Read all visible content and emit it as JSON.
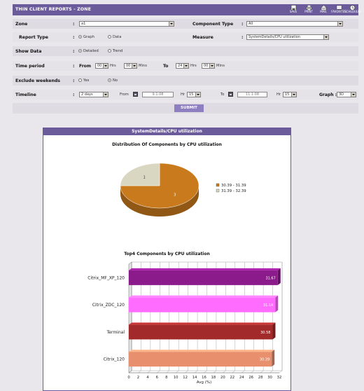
{
  "header": {
    "title": "THIN CLIENT REPORTS - ZONE",
    "buttons": [
      {
        "label": "SAVE",
        "icon": "save-icon"
      },
      {
        "label": "PRINT",
        "icon": "print-icon"
      },
      {
        "label": "MAIL",
        "icon": "mail-icon"
      },
      {
        "label": "FAVORITES",
        "icon": "favorites-icon"
      },
      {
        "label": "SCHEDULES",
        "icon": "schedules-icon"
      }
    ]
  },
  "form": {
    "zone_label": "Zone",
    "zone_value": "a1",
    "component_type_label": "Component Type",
    "component_type_value": "All",
    "report_type_label": "Report Type",
    "report_type_graph": "Graph",
    "report_type_data": "Data",
    "measure_label": "Measure",
    "measure_value": "SystemDetails/CPU utilization",
    "show_data_label": "Show Data",
    "show_data_detailed": "Detailed",
    "show_data_trend": "Trend",
    "time_period_label": "Time period",
    "from_label": "From",
    "from_hrs": "00",
    "from_mins": "00",
    "to_label": "To",
    "to_hrs": "24",
    "to_mins": "00",
    "hrs_label": "Hrs",
    "mins_label": "Mins",
    "exclude_weekends_label": "Exclude weekends",
    "yes_label": "Yes",
    "no_label": "No",
    "timeline_label": "Timeline",
    "timeline_value": "2 days",
    "timeline_from_label": "From",
    "timeline_from_date": "9.1.08",
    "timeline_from_hr": "15",
    "timeline_to_label": "To",
    "timeline_to_date": "11.1.08",
    "timeline_to_hr": "15",
    "hr_label": "Hr",
    "graph_label": "Graph :",
    "graph_value": "3D",
    "submit_label": "SUBMIT"
  },
  "panel": {
    "title": "SystemDetails/CPU utilization"
  },
  "chart_data": [
    {
      "type": "pie",
      "title": "Distribution Of Components by CPU utilization",
      "categories": [
        "30.39 - 31.39",
        "31.39 - 32.39"
      ],
      "values": [
        3,
        1
      ],
      "colors": [
        "#c97a1d",
        "#d9d7c1"
      ],
      "legend": "right"
    },
    {
      "type": "bar",
      "orientation": "horizontal",
      "title": "Top4 Components by CPU utilization",
      "categories": [
        "Citrix_MF_XP_120",
        "Citrix_ZDC_120",
        "Terminal",
        "Citrix_120"
      ],
      "values": [
        31.67,
        31.14,
        30.58,
        30.39
      ],
      "colors": [
        "#8b1a8b",
        "#ff6cff",
        "#a32a2a",
        "#e8906e"
      ],
      "xlabel": "Avg (%)",
      "xlim": [
        0,
        32
      ],
      "xticks": [
        "0",
        "2",
        "4",
        "6",
        "8",
        "10",
        "12",
        "14",
        "16",
        "18",
        "20",
        "22",
        "24",
        "26",
        "28",
        "30",
        "32"
      ],
      "grid": true
    }
  ]
}
